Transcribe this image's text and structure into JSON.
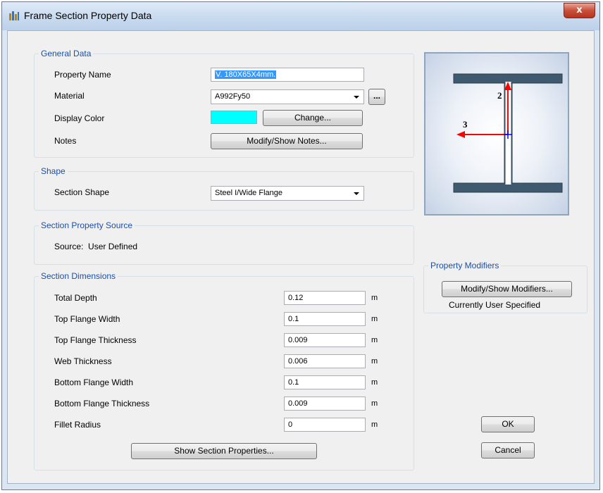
{
  "window": {
    "title": "Frame Section Property Data",
    "close_label": "x"
  },
  "general": {
    "legend": "General Data",
    "property_name_label": "Property Name",
    "property_name_value": "V. 180X65X4mm.",
    "material_label": "Material",
    "material_value": "A992Fy50",
    "material_more_label": "...",
    "display_color_label": "Display Color",
    "display_color_value": "#00ffff",
    "change_button": "Change...",
    "notes_label": "Notes",
    "notes_button": "Modify/Show Notes..."
  },
  "shape": {
    "legend": "Shape",
    "section_shape_label": "Section Shape",
    "section_shape_value": "Steel I/Wide Flange"
  },
  "source": {
    "legend": "Section Property Source",
    "text": "Source:  User Defined"
  },
  "dimensions": {
    "legend": "Section Dimensions",
    "rows": [
      {
        "label": "Total Depth",
        "value": "0.12",
        "unit": "m"
      },
      {
        "label": "Top Flange Width",
        "value": "0.1",
        "unit": "m"
      },
      {
        "label": "Top Flange Thickness",
        "value": "0.009",
        "unit": "m"
      },
      {
        "label": "Web Thickness",
        "value": "0.006",
        "unit": "m"
      },
      {
        "label": "Bottom Flange Width",
        "value": "0.1",
        "unit": "m"
      },
      {
        "label": "Bottom Flange Thickness",
        "value": "0.009",
        "unit": "m"
      },
      {
        "label": "Fillet Radius",
        "value": "0",
        "unit": "m"
      }
    ],
    "show_properties_button": "Show Section Properties..."
  },
  "preview": {
    "axis_2_label": "2",
    "axis_3_label": "3"
  },
  "modifiers": {
    "legend": "Property Modifiers",
    "button": "Modify/Show Modifiers...",
    "status": "Currently User Specified"
  },
  "actions": {
    "ok": "OK",
    "cancel": "Cancel"
  }
}
